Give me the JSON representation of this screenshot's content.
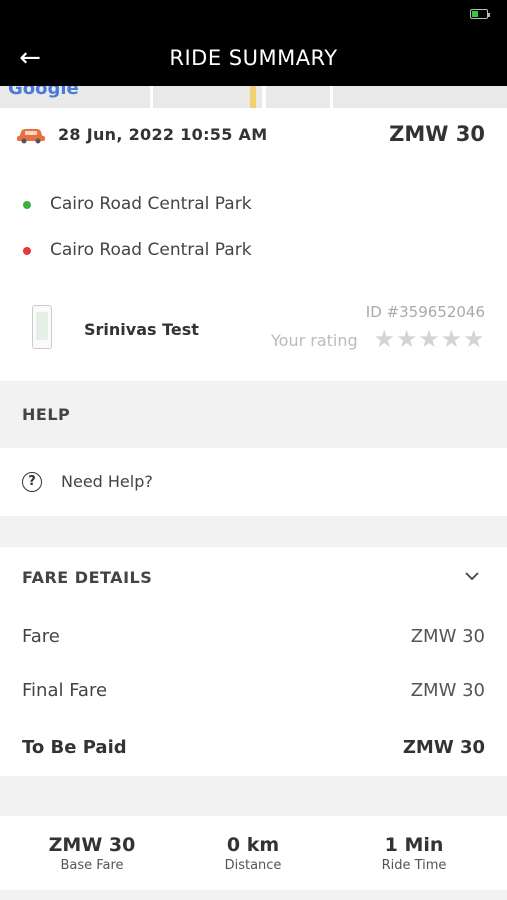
{
  "header": {
    "title": "RIDE SUMMARY"
  },
  "ride": {
    "datetime": "28 Jun, 2022 10:55 AM",
    "total": "ZMW 30",
    "pickup": "Cairo Road Central Park",
    "dropoff": "Cairo Road Central Park",
    "driver_name": "Srinivas Test",
    "ride_id": "ID #359652046",
    "rating_label": "Your rating",
    "rating_value": 0,
    "rating_max": 5
  },
  "help": {
    "title": "HELP",
    "need_help": "Need Help?"
  },
  "fare": {
    "title": "FARE DETAILS",
    "rows": [
      {
        "label": "Fare",
        "value": "ZMW 30"
      },
      {
        "label": "Final Fare",
        "value": "ZMW 30"
      },
      {
        "label": "To Be Paid",
        "value": "ZMW 30"
      }
    ]
  },
  "stats": [
    {
      "value": "ZMW 30",
      "label": "Base Fare"
    },
    {
      "value": "0 km",
      "label": "Distance"
    },
    {
      "value": "1 Min",
      "label": "Ride Time"
    }
  ],
  "colors": {
    "pickup_dot": "#3cb043",
    "dropoff_dot": "#e53935",
    "car": "#e87040"
  }
}
